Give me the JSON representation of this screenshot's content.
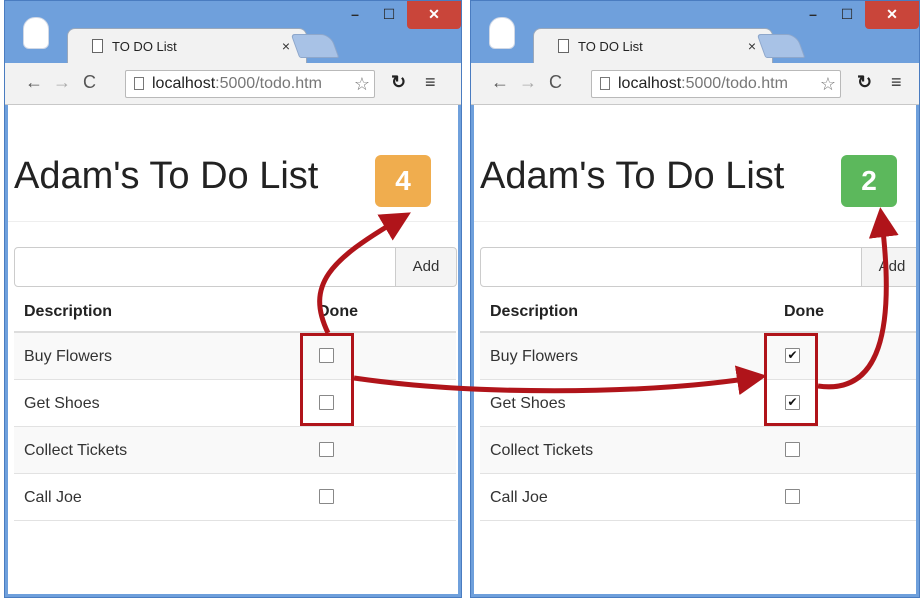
{
  "colors": {
    "badge_left": "#f0ad4e",
    "badge_right": "#5cb85c",
    "window_frame": "#6fa0dc",
    "annotation": "#b0141a",
    "close_button": "#c9453a"
  },
  "windows": [
    {
      "tab_title": "TO DO List",
      "tab_close": "×",
      "url_host": "localhost",
      "url_rest": ":5000/todo.htm",
      "page_title": "Adam's To Do List",
      "badge_count": "4",
      "badge_color": "#f0ad4e",
      "add_label": "Add",
      "new_item_value": "",
      "col_description": "Description",
      "col_done": "Done",
      "items": [
        {
          "description": "Buy Flowers",
          "done": false,
          "mark": ""
        },
        {
          "description": "Get Shoes",
          "done": false,
          "mark": ""
        },
        {
          "description": "Collect Tickets",
          "done": false,
          "mark": ""
        },
        {
          "description": "Call Joe",
          "done": false,
          "mark": ""
        }
      ]
    },
    {
      "tab_title": "TO DO List",
      "tab_close": "×",
      "url_host": "localhost",
      "url_rest": ":5000/todo.htm",
      "page_title": "Adam's To Do List",
      "badge_count": "2",
      "badge_color": "#5cb85c",
      "add_label": "Add",
      "new_item_value": "",
      "col_description": "Description",
      "col_done": "Done",
      "items": [
        {
          "description": "Buy Flowers",
          "done": true,
          "mark": "✔"
        },
        {
          "description": "Get Shoes",
          "done": true,
          "mark": "✔"
        },
        {
          "description": "Collect Tickets",
          "done": false,
          "mark": ""
        },
        {
          "description": "Call Joe",
          "done": false,
          "mark": ""
        }
      ]
    }
  ],
  "icons": {
    "back": "back-arrow-icon",
    "forward": "forward-arrow-icon",
    "reload": "reload-icon",
    "star": "bookmark-star-icon",
    "extension": "extension-icon",
    "menu": "hamburger-menu-icon",
    "profile": "profile-avatar-icon"
  }
}
